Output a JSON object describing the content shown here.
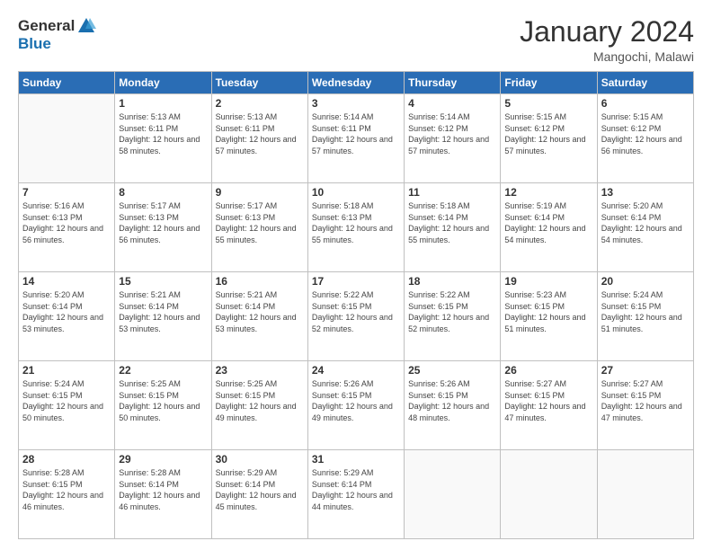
{
  "header": {
    "logo_general": "General",
    "logo_blue": "Blue",
    "title": "January 2024",
    "subtitle": "Mangochi, Malawi"
  },
  "columns": [
    "Sunday",
    "Monday",
    "Tuesday",
    "Wednesday",
    "Thursday",
    "Friday",
    "Saturday"
  ],
  "weeks": [
    [
      {
        "day": "",
        "sunrise": "",
        "sunset": "",
        "daylight": ""
      },
      {
        "day": "1",
        "sunrise": "Sunrise: 5:13 AM",
        "sunset": "Sunset: 6:11 PM",
        "daylight": "Daylight: 12 hours and 58 minutes."
      },
      {
        "day": "2",
        "sunrise": "Sunrise: 5:13 AM",
        "sunset": "Sunset: 6:11 PM",
        "daylight": "Daylight: 12 hours and 57 minutes."
      },
      {
        "day": "3",
        "sunrise": "Sunrise: 5:14 AM",
        "sunset": "Sunset: 6:11 PM",
        "daylight": "Daylight: 12 hours and 57 minutes."
      },
      {
        "day": "4",
        "sunrise": "Sunrise: 5:14 AM",
        "sunset": "Sunset: 6:12 PM",
        "daylight": "Daylight: 12 hours and 57 minutes."
      },
      {
        "day": "5",
        "sunrise": "Sunrise: 5:15 AM",
        "sunset": "Sunset: 6:12 PM",
        "daylight": "Daylight: 12 hours and 57 minutes."
      },
      {
        "day": "6",
        "sunrise": "Sunrise: 5:15 AM",
        "sunset": "Sunset: 6:12 PM",
        "daylight": "Daylight: 12 hours and 56 minutes."
      }
    ],
    [
      {
        "day": "7",
        "sunrise": "Sunrise: 5:16 AM",
        "sunset": "Sunset: 6:13 PM",
        "daylight": "Daylight: 12 hours and 56 minutes."
      },
      {
        "day": "8",
        "sunrise": "Sunrise: 5:17 AM",
        "sunset": "Sunset: 6:13 PM",
        "daylight": "Daylight: 12 hours and 56 minutes."
      },
      {
        "day": "9",
        "sunrise": "Sunrise: 5:17 AM",
        "sunset": "Sunset: 6:13 PM",
        "daylight": "Daylight: 12 hours and 55 minutes."
      },
      {
        "day": "10",
        "sunrise": "Sunrise: 5:18 AM",
        "sunset": "Sunset: 6:13 PM",
        "daylight": "Daylight: 12 hours and 55 minutes."
      },
      {
        "day": "11",
        "sunrise": "Sunrise: 5:18 AM",
        "sunset": "Sunset: 6:14 PM",
        "daylight": "Daylight: 12 hours and 55 minutes."
      },
      {
        "day": "12",
        "sunrise": "Sunrise: 5:19 AM",
        "sunset": "Sunset: 6:14 PM",
        "daylight": "Daylight: 12 hours and 54 minutes."
      },
      {
        "day": "13",
        "sunrise": "Sunrise: 5:20 AM",
        "sunset": "Sunset: 6:14 PM",
        "daylight": "Daylight: 12 hours and 54 minutes."
      }
    ],
    [
      {
        "day": "14",
        "sunrise": "Sunrise: 5:20 AM",
        "sunset": "Sunset: 6:14 PM",
        "daylight": "Daylight: 12 hours and 53 minutes."
      },
      {
        "day": "15",
        "sunrise": "Sunrise: 5:21 AM",
        "sunset": "Sunset: 6:14 PM",
        "daylight": "Daylight: 12 hours and 53 minutes."
      },
      {
        "day": "16",
        "sunrise": "Sunrise: 5:21 AM",
        "sunset": "Sunset: 6:14 PM",
        "daylight": "Daylight: 12 hours and 53 minutes."
      },
      {
        "day": "17",
        "sunrise": "Sunrise: 5:22 AM",
        "sunset": "Sunset: 6:15 PM",
        "daylight": "Daylight: 12 hours and 52 minutes."
      },
      {
        "day": "18",
        "sunrise": "Sunrise: 5:22 AM",
        "sunset": "Sunset: 6:15 PM",
        "daylight": "Daylight: 12 hours and 52 minutes."
      },
      {
        "day": "19",
        "sunrise": "Sunrise: 5:23 AM",
        "sunset": "Sunset: 6:15 PM",
        "daylight": "Daylight: 12 hours and 51 minutes."
      },
      {
        "day": "20",
        "sunrise": "Sunrise: 5:24 AM",
        "sunset": "Sunset: 6:15 PM",
        "daylight": "Daylight: 12 hours and 51 minutes."
      }
    ],
    [
      {
        "day": "21",
        "sunrise": "Sunrise: 5:24 AM",
        "sunset": "Sunset: 6:15 PM",
        "daylight": "Daylight: 12 hours and 50 minutes."
      },
      {
        "day": "22",
        "sunrise": "Sunrise: 5:25 AM",
        "sunset": "Sunset: 6:15 PM",
        "daylight": "Daylight: 12 hours and 50 minutes."
      },
      {
        "day": "23",
        "sunrise": "Sunrise: 5:25 AM",
        "sunset": "Sunset: 6:15 PM",
        "daylight": "Daylight: 12 hours and 49 minutes."
      },
      {
        "day": "24",
        "sunrise": "Sunrise: 5:26 AM",
        "sunset": "Sunset: 6:15 PM",
        "daylight": "Daylight: 12 hours and 49 minutes."
      },
      {
        "day": "25",
        "sunrise": "Sunrise: 5:26 AM",
        "sunset": "Sunset: 6:15 PM",
        "daylight": "Daylight: 12 hours and 48 minutes."
      },
      {
        "day": "26",
        "sunrise": "Sunrise: 5:27 AM",
        "sunset": "Sunset: 6:15 PM",
        "daylight": "Daylight: 12 hours and 47 minutes."
      },
      {
        "day": "27",
        "sunrise": "Sunrise: 5:27 AM",
        "sunset": "Sunset: 6:15 PM",
        "daylight": "Daylight: 12 hours and 47 minutes."
      }
    ],
    [
      {
        "day": "28",
        "sunrise": "Sunrise: 5:28 AM",
        "sunset": "Sunset: 6:15 PM",
        "daylight": "Daylight: 12 hours and 46 minutes."
      },
      {
        "day": "29",
        "sunrise": "Sunrise: 5:28 AM",
        "sunset": "Sunset: 6:14 PM",
        "daylight": "Daylight: 12 hours and 46 minutes."
      },
      {
        "day": "30",
        "sunrise": "Sunrise: 5:29 AM",
        "sunset": "Sunset: 6:14 PM",
        "daylight": "Daylight: 12 hours and 45 minutes."
      },
      {
        "day": "31",
        "sunrise": "Sunrise: 5:29 AM",
        "sunset": "Sunset: 6:14 PM",
        "daylight": "Daylight: 12 hours and 44 minutes."
      },
      {
        "day": "",
        "sunrise": "",
        "sunset": "",
        "daylight": ""
      },
      {
        "day": "",
        "sunrise": "",
        "sunset": "",
        "daylight": ""
      },
      {
        "day": "",
        "sunrise": "",
        "sunset": "",
        "daylight": ""
      }
    ]
  ]
}
